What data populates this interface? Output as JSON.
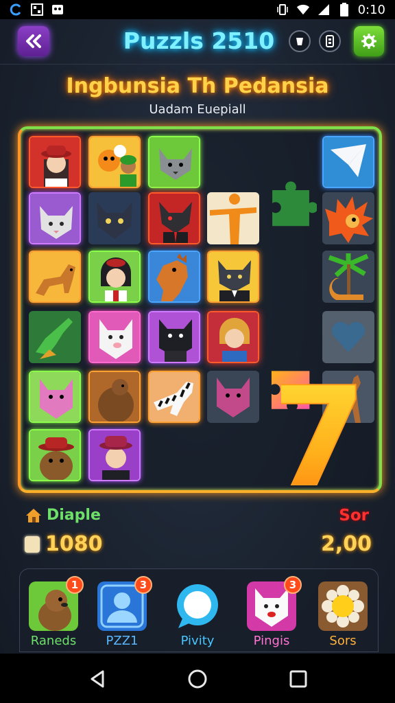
{
  "status_bar": {
    "time": "0:10"
  },
  "header": {
    "title": "Puzzls 2510"
  },
  "level": {
    "title": "Ingbunsia Th Pedansia",
    "subtitle": "Uadam Euepiall"
  },
  "board": {
    "highlight_number": "7"
  },
  "scores": {
    "left_label": "Diaple",
    "left_value": "1080",
    "right_label": "Sor",
    "right_value": "2,00"
  },
  "dock": {
    "items": [
      {
        "label": "Raneds",
        "badge": "1",
        "label_color": "#6ee06a"
      },
      {
        "label": "PZZ1",
        "badge": "3",
        "label_color": "#5ab8ff"
      },
      {
        "label": "Pivity",
        "badge": "",
        "label_color": "#49c6ff"
      },
      {
        "label": "Pingis",
        "badge": "3",
        "label_color": "#ff73d2"
      },
      {
        "label": "Sors",
        "badge": "",
        "label_color": "#ffb13a"
      }
    ]
  },
  "colors": {
    "accent_title": "#7ff0ff",
    "board_border": "#7de04a",
    "score_value": "#ffd35a"
  }
}
